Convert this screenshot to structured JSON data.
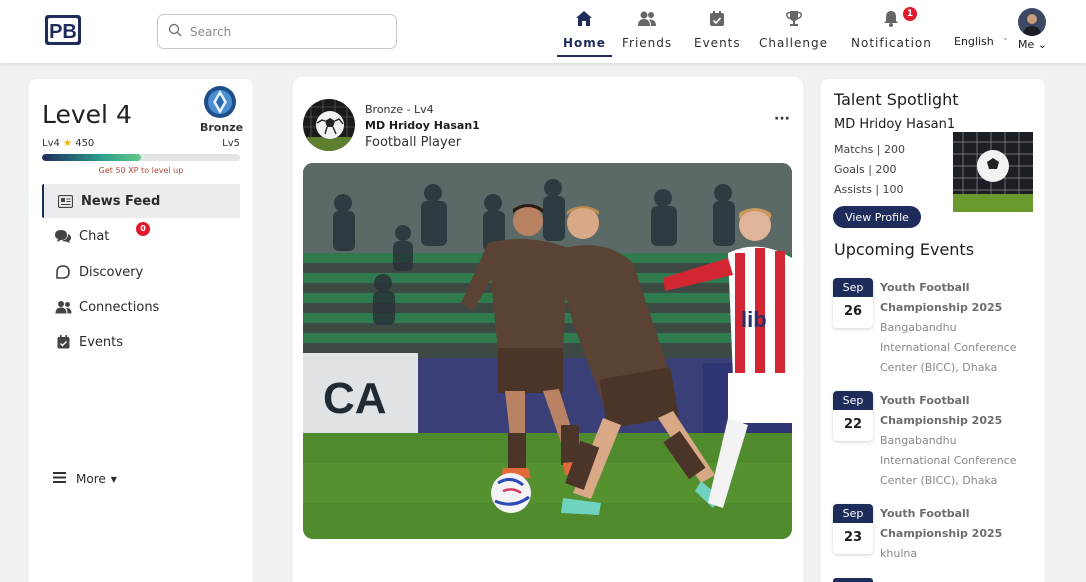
{
  "colors": {
    "brand": "#1d2c5a",
    "badge": "#e0192b",
    "xp_note": "#b04a3c"
  },
  "header": {
    "logo_text": "PB",
    "search_placeholder": "Search",
    "nav": [
      {
        "label": "Home",
        "icon": "home-icon",
        "active": true
      },
      {
        "label": "Friends",
        "icon": "friends-icon"
      },
      {
        "label": "Events",
        "icon": "calendar-icon"
      },
      {
        "label": "Challenge",
        "icon": "trophy-icon"
      },
      {
        "label": "Notification",
        "icon": "bell-icon",
        "badge": "1"
      }
    ],
    "language": "English",
    "me_label": "Me"
  },
  "profile": {
    "level_title": "Level 4",
    "badge_label": "Bronze",
    "current_level": "Lv4",
    "xp": "450",
    "next_level": "Lv5",
    "progress_fraction": 0.5,
    "xp_note": "Get 50 XP to level up"
  },
  "sidebar": {
    "items": [
      {
        "label": "News Feed",
        "icon": "newspaper-icon",
        "active": true
      },
      {
        "label": "Chat",
        "icon": "chat-icon",
        "badge": "0"
      },
      {
        "label": "Discovery",
        "icon": "discovery-icon"
      },
      {
        "label": "Connections",
        "icon": "connections-icon"
      },
      {
        "label": "Events",
        "icon": "calendar-icon"
      }
    ],
    "more_label": "More"
  },
  "post": {
    "meta": "Bronze - Lv4",
    "author": "MD Hridoy Hasan1",
    "role": "Football Player",
    "menu": "···"
  },
  "spotlight": {
    "title": "Talent Spotlight",
    "name": "MD Hridoy Hasan1",
    "matches": "Matchs | 200",
    "goals": "Goals | 200",
    "assists": "Assists | 100",
    "button": "View Profile"
  },
  "upcoming": {
    "title": "Upcoming Events",
    "events": [
      {
        "month": "Sep",
        "day": "26",
        "lines": [
          "Youth Football",
          "Championship 2025",
          "Bangabandhu",
          "International Conference",
          "Center (BICC), Dhaka"
        ]
      },
      {
        "month": "Sep",
        "day": "22",
        "lines": [
          "Youth Football",
          "Championship 2025",
          "Bangabandhu",
          "International Conference",
          "Center (BICC), Dhaka"
        ]
      },
      {
        "month": "Sep",
        "day": "23",
        "lines": [
          "Youth Football",
          "Championship 2025",
          "khulna"
        ]
      }
    ]
  }
}
